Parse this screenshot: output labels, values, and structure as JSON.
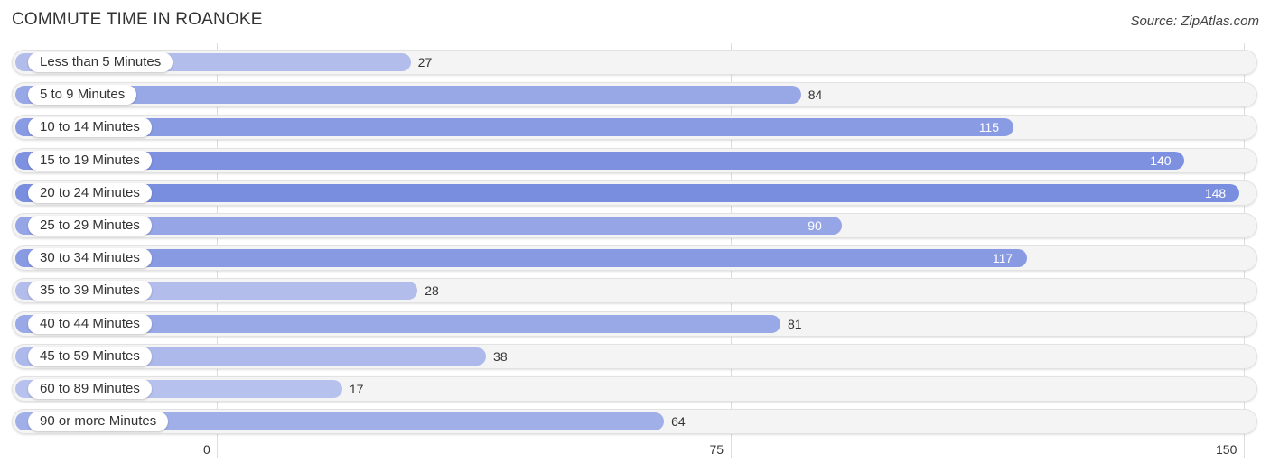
{
  "chart_data": {
    "type": "bar",
    "orientation": "horizontal",
    "title": "COMMUTE TIME IN ROANOKE",
    "source": "Source: ZipAtlas.com",
    "categories": [
      "Less than 5 Minutes",
      "5 to 9 Minutes",
      "10 to 14 Minutes",
      "15 to 19 Minutes",
      "20 to 24 Minutes",
      "25 to 29 Minutes",
      "30 to 34 Minutes",
      "35 to 39 Minutes",
      "40 to 44 Minutes",
      "45 to 59 Minutes",
      "60 to 89 Minutes",
      "90 or more Minutes"
    ],
    "values": [
      27,
      84,
      115,
      140,
      148,
      90,
      117,
      28,
      81,
      38,
      17,
      64
    ],
    "xlim": [
      0,
      150
    ],
    "xticks": [
      "0",
      "75",
      "150"
    ],
    "grid": true,
    "colors": {
      "low": "#b7c1ed",
      "high": "#7a8edf"
    }
  }
}
